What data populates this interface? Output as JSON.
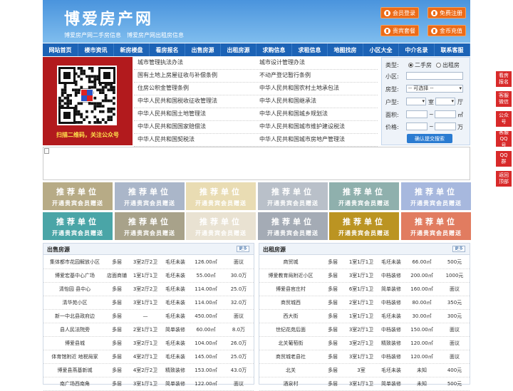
{
  "header": {
    "title": "博爱房产网",
    "subtitle": "博爱房产网二手房信息　博爱房产网出租房信息",
    "buttons": [
      "会员登录",
      "免费注册",
      "贵宾套餐",
      "金币充值"
    ]
  },
  "nav": [
    "网站首页",
    "楼市资讯",
    "新房楼盘",
    "看房报名",
    "出售房源",
    "出租房源",
    "求购信息",
    "求租信息",
    "地图找房",
    "小区大全",
    "中介名录",
    "联系客服"
  ],
  "qr": {
    "caption": "扫描二维码，关注公众号"
  },
  "links": {
    "left": [
      "城市管理执法办法",
      "国有土地上房屋征收与补偿条例",
      "住房公积金管理条例",
      "中华人民共和国税收征收管理法",
      "中华人民共和国土地管理法",
      "中华人民共和国国家赔偿法",
      "中华人民共和国契税法"
    ],
    "right": [
      "城市设计管理办法",
      "不动产登记暂行条例",
      "中华人民共和国农村土地承包法",
      "中华人民共和国继承法",
      "中华人民共和国城乡规划法",
      "中华人民共和国城市维护建设税法",
      "中华人民共和国城市房地产管理法"
    ]
  },
  "search": {
    "type_label": "类型:",
    "opt1": "二手房",
    "opt2": "出租房",
    "xq_label": "小区:",
    "fx_label": "房型:",
    "fx_select": "-- 可选择 --",
    "hx_label": "户型:",
    "shi": "室",
    "ting": "厅",
    "mj_label": "面积:",
    "m2": "㎡",
    "jg_label": "价格:",
    "wan": "万",
    "button": "确认提交搜索"
  },
  "ads": {
    "t1": "推荐单位",
    "t2": "开通贵宾会员赠送",
    "colors": [
      "#b7ab86",
      "#aab6c9",
      "#e9dcb3",
      "#b9c0c9",
      "#8fb0ad",
      "#a7b8de",
      "#4aa5a7",
      "#a8a28a",
      "#e9e2d2",
      "#a4abb5",
      "#bb9422",
      "#e17c60"
    ]
  },
  "sale": {
    "title": "出售房源",
    "more": "更多",
    "rows": [
      [
        "集体都市花园解放小区",
        "多层",
        "3室2厅2卫",
        "毛坯未装",
        "126.00㎡",
        "面议"
      ],
      [
        "博爱宏基中心广场",
        "店面商铺",
        "1室1厅1卫",
        "毛坯未装",
        "55.00㎡",
        "30.0万"
      ],
      [
        "清怡园 县中心",
        "多层",
        "3室2厅2卫",
        "毛坯未装",
        "114.00㎡",
        "25.0万"
      ],
      [
        "清华苑小区",
        "多层",
        "3室1厅1卫",
        "毛坯未装",
        "114.00㎡",
        "32.0万"
      ],
      [
        "新一中北县政府边",
        "多层",
        "—",
        "毛坯未装",
        "450.00㎡",
        "面议"
      ],
      [
        "县人民法院旁",
        "多层",
        "2室1厅1卫",
        "简单装修",
        "60.00㎡",
        "8.0万"
      ],
      [
        "博爱县城",
        "多层",
        "3室2厅1卫",
        "毛坯未装",
        "104.00㎡",
        "26.0万"
      ],
      [
        "体育馆附近 地税局家",
        "多层",
        "4室2厅1卫",
        "毛坯未装",
        "145.00㎡",
        "25.0万"
      ],
      [
        "博爱县燕基新城",
        "多层",
        "4室2厅2卫",
        "精致装修",
        "153.00㎡",
        "43.0万"
      ],
      [
        "南广场西南角",
        "多层",
        "3室1厅1卫",
        "简单装修",
        "122.00㎡",
        "面议"
      ]
    ]
  },
  "rent": {
    "title": "出租房源",
    "more": "更多",
    "rows": [
      [
        "商贸城",
        "多层",
        "1室1厅1卫",
        "毛坯未装",
        "66.00㎡",
        "500元"
      ],
      [
        "博爱教育局附近小区",
        "多层",
        "3室1厅1卫",
        "中档装修",
        "200.00㎡",
        "1000元"
      ],
      [
        "博爱县官庄村",
        "多层",
        "6室1厅1卫",
        "简单装修",
        "160.00㎡",
        "面议"
      ],
      [
        "商贸城西",
        "多层",
        "2室1厅1卫",
        "中档装修",
        "80.00㎡",
        "350元"
      ],
      [
        "西大街",
        "多层",
        "1室1厅1卫",
        "毛坯未装",
        "30.00㎡",
        "300元"
      ],
      [
        "世纪花苑后面",
        "多层",
        "3室2厅1卫",
        "中档装修",
        "150.00㎡",
        "面议"
      ],
      [
        "北关葡萄街",
        "多层",
        "3室2厅1卫",
        "精致装修",
        "120.00㎡",
        "面议"
      ],
      [
        "商贸城老县社",
        "多层",
        "3室1厅1卫",
        "中档装修",
        "120.00㎡",
        "面议"
      ],
      [
        "北关",
        "多层",
        "3室",
        "毛坯未装",
        "未知",
        "400元"
      ],
      [
        "酒泉村",
        "多层",
        "3室1厅1卫",
        "简单装修",
        "未知",
        "500元"
      ]
    ]
  },
  "side": [
    "看房报名",
    "客服微信",
    "公众号",
    "客服QQ号",
    "QQ群",
    "返回顶部"
  ]
}
